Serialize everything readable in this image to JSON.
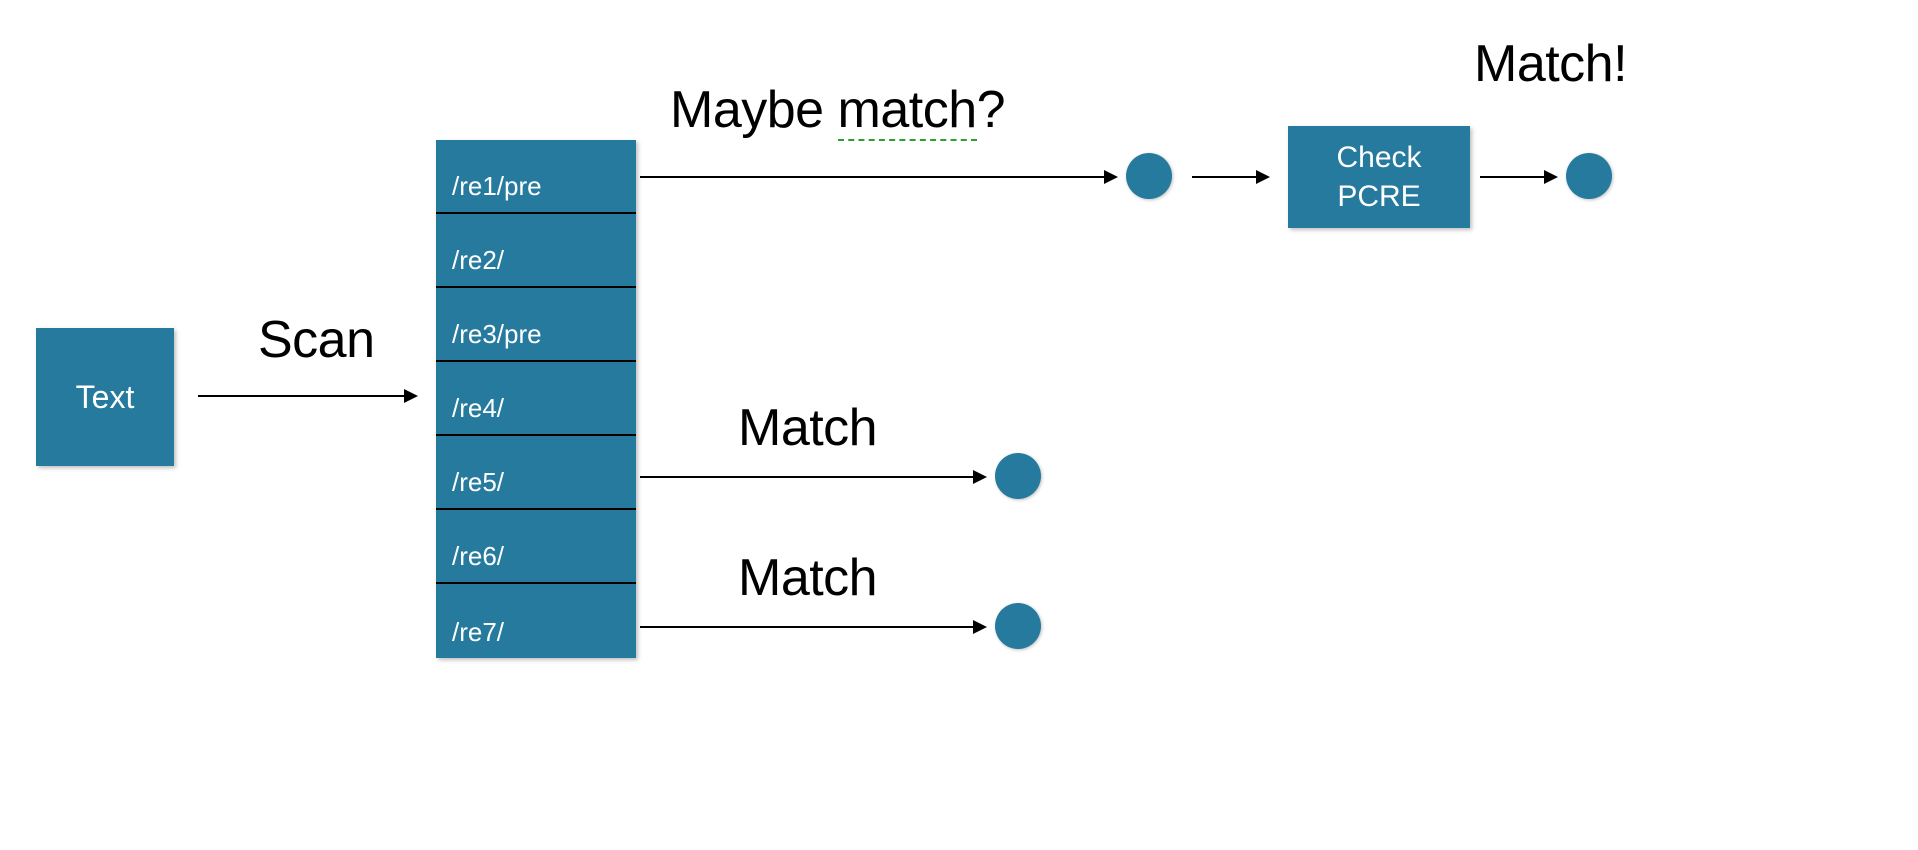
{
  "text_block": {
    "label": "Text"
  },
  "scan_label": "Scan",
  "stack": {
    "rows": [
      {
        "label": "/re1/pre"
      },
      {
        "label": "/re2/"
      },
      {
        "label": "/re3/pre"
      },
      {
        "label": "/re4/"
      },
      {
        "label": "/re5/"
      },
      {
        "label": "/re6/"
      },
      {
        "label": "/re7/"
      }
    ]
  },
  "maybe_match_label_pre": "Maybe ",
  "maybe_match_label_word": "match",
  "maybe_match_label_post": "?",
  "match_label_1": "Match",
  "match_label_2": "Match",
  "check_pcre": {
    "line1": "Check",
    "line2": "PCRE"
  },
  "match_exclaim": "Match!"
}
